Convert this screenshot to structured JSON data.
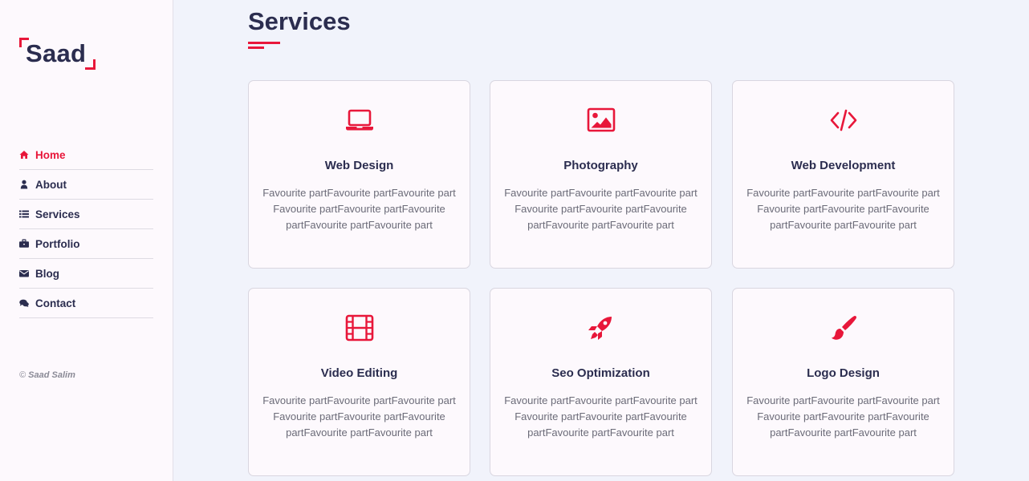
{
  "brand": {
    "logo_text": "Saad",
    "accent": "#e8173a",
    "dark": "#2b2d4f"
  },
  "nav": [
    {
      "label": "Home",
      "icon": "home-icon",
      "active": true
    },
    {
      "label": "About",
      "icon": "user-icon",
      "active": false
    },
    {
      "label": "Services",
      "icon": "list-icon",
      "active": false
    },
    {
      "label": "Portfolio",
      "icon": "briefcase-icon",
      "active": false
    },
    {
      "label": "Blog",
      "icon": "envelope-icon",
      "active": false
    },
    {
      "label": "Contact",
      "icon": "comments-icon",
      "active": false
    }
  ],
  "copyright": {
    "symbol": "©",
    "name": "Saad Salim"
  },
  "page": {
    "title": "Services"
  },
  "services": [
    {
      "title": "Web Design",
      "icon": "laptop-icon",
      "description": "Favourite partFavourite partFavourite part Favourite partFavourite partFavourite partFavourite partFavourite part"
    },
    {
      "title": "Photography",
      "icon": "image-icon",
      "description": "Favourite partFavourite partFavourite part Favourite partFavourite partFavourite partFavourite partFavourite part"
    },
    {
      "title": "Web Development",
      "icon": "code-icon",
      "description": "Favourite partFavourite partFavourite part Favourite partFavourite partFavourite partFavourite partFavourite part"
    },
    {
      "title": "Video Editing",
      "icon": "film-icon",
      "description": "Favourite partFavourite partFavourite part Favourite partFavourite partFavourite partFavourite partFavourite part"
    },
    {
      "title": "Seo Optimization",
      "icon": "rocket-icon",
      "description": "Favourite partFavourite partFavourite part Favourite partFavourite partFavourite partFavourite partFavourite part"
    },
    {
      "title": "Logo Design",
      "icon": "paint-brush-icon",
      "description": "Favourite partFavourite partFavourite part Favourite partFavourite partFavourite partFavourite partFavourite part"
    }
  ]
}
